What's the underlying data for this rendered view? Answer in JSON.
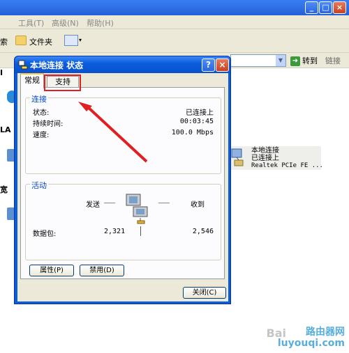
{
  "explorer": {
    "menu": [
      "工具(T)",
      "高级(N)",
      "帮助(H)"
    ],
    "toolbar": {
      "search_tail": "索",
      "folders": "文件夹"
    },
    "go_label": "转到",
    "links_label": "链接",
    "left_labels": [
      "I",
      "LA",
      "宽"
    ],
    "connection_item": {
      "name": "本地连接",
      "status": "已连接上",
      "adapter": "Realtek PCIe FE ..."
    },
    "watermark": {
      "baidu": "Bai",
      "site_cn": "路由器网",
      "site_en": "luyouqi.com"
    }
  },
  "dialog": {
    "title": "本地连接 状态",
    "help_icon": "?",
    "close_icon": "×",
    "tabs": [
      "常规",
      "支持"
    ],
    "connection": {
      "title": "连接",
      "rows": [
        {
          "label": "状态:",
          "value": "已连接上"
        },
        {
          "label": "持续时间:",
          "value": "00:03:45"
        },
        {
          "label": "速度:",
          "value": "100.0 Mbps"
        }
      ]
    },
    "activity": {
      "title": "活动",
      "sent_label": "发送",
      "received_label": "收到",
      "packets_label": "数据包:",
      "sent_value": "2,321",
      "received_value": "2,546"
    },
    "buttons": {
      "properties": "属性(P)",
      "disable": "禁用(D)",
      "close": "关闭(C)"
    }
  },
  "colors": {
    "title_blue": "#0a5ddb",
    "highlight_red": "#e02020",
    "group_title": "#0046d5"
  }
}
